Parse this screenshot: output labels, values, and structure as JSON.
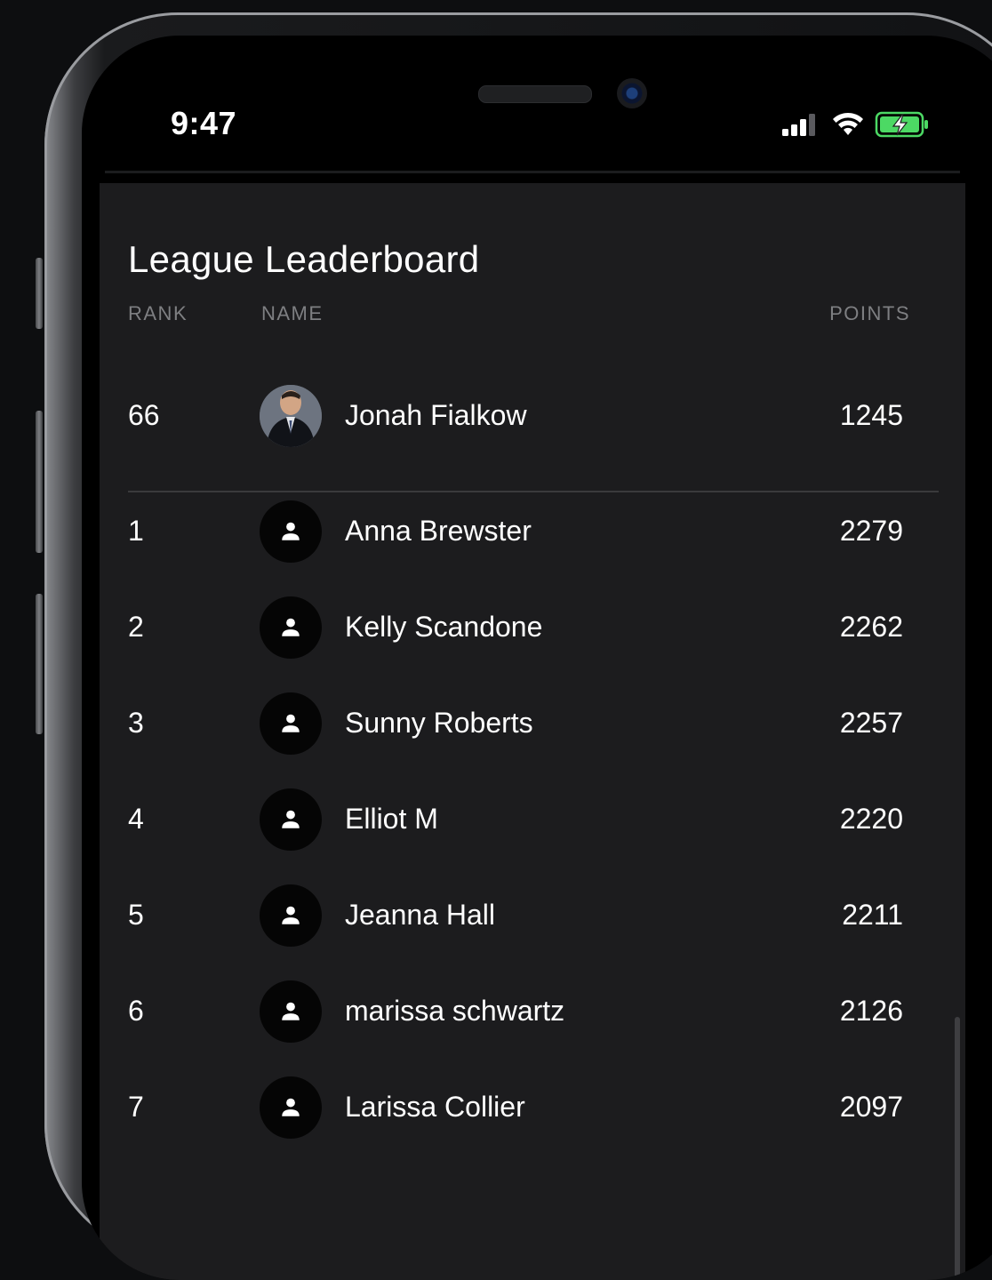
{
  "status_bar": {
    "time": "9:47",
    "icons": [
      "cellular-signal-icon",
      "wifi-icon",
      "battery-charging-icon"
    ],
    "battery_color": "#4cd964"
  },
  "leaderboard": {
    "title": "League Leaderboard",
    "columns": {
      "rank": "RANK",
      "name": "NAME",
      "points": "POINTS"
    },
    "current_user": {
      "rank": "66",
      "name": "Jonah Fialkow",
      "points": "1245",
      "avatar": "profile-photo"
    },
    "rows": [
      {
        "rank": "1",
        "name": "Anna Brewster",
        "points": "2279",
        "avatar": "person-icon"
      },
      {
        "rank": "2",
        "name": "Kelly Scandone",
        "points": "2262",
        "avatar": "person-icon"
      },
      {
        "rank": "3",
        "name": "Sunny Roberts",
        "points": "2257",
        "avatar": "person-icon"
      },
      {
        "rank": "4",
        "name": "Elliot M",
        "points": "2220",
        "avatar": "person-icon"
      },
      {
        "rank": "5",
        "name": "Jeanna Hall",
        "points": "2211",
        "avatar": "person-icon"
      },
      {
        "rank": "6",
        "name": "marissa schwartz",
        "points": "2126",
        "avatar": "person-icon"
      },
      {
        "rank": "7",
        "name": "Larissa Collier",
        "points": "2097",
        "avatar": "person-icon"
      }
    ]
  },
  "colors": {
    "background": "#0d0e10",
    "card": "#1c1c1e",
    "text": "#ffffff",
    "muted": "#7e7f82",
    "avatar_bg": "#050505"
  }
}
